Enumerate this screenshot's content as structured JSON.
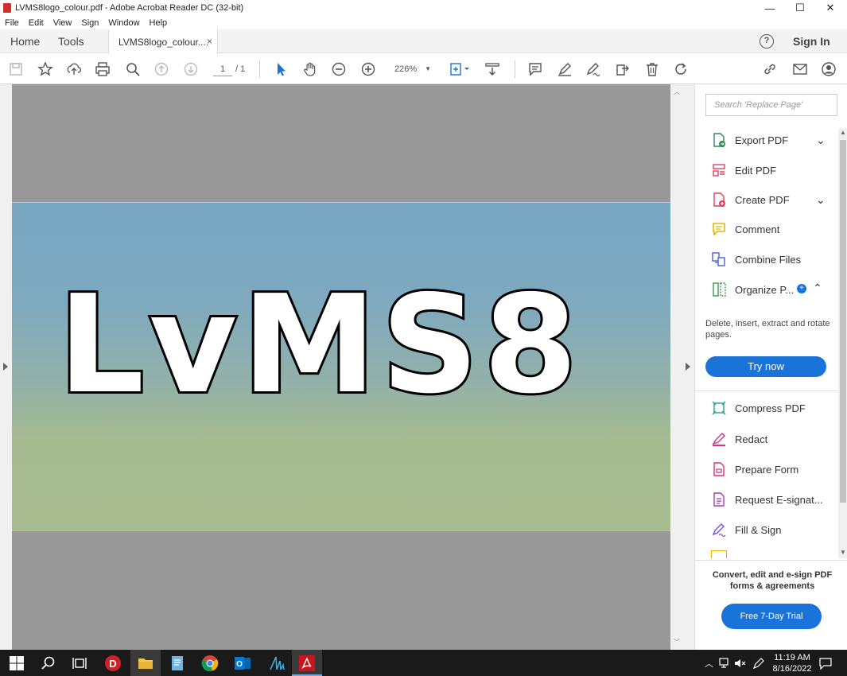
{
  "window": {
    "title": "LVMS8logo_colour.pdf - Adobe Acrobat Reader DC (32-bit)",
    "controls": {
      "minimize": "—",
      "maximize": "☐",
      "close": "✕"
    }
  },
  "menu": [
    "File",
    "Edit",
    "View",
    "Sign",
    "Window",
    "Help"
  ],
  "tabs": {
    "home": "Home",
    "tools": "Tools",
    "document": "LVMS8logo_colour....",
    "close": "×",
    "help": "?",
    "sign_in": "Sign In"
  },
  "toolbar": {
    "page_current": "1",
    "page_total": "/ 1",
    "zoom": "226%",
    "zoom_caret": "▼",
    "icons": [
      "save-icon",
      "bookmark-star-icon",
      "upload-cloud-icon",
      "print-icon",
      "find-icon",
      "previous-page-icon",
      "next-page-icon",
      "select-arrow-icon",
      "hand-icon",
      "zoom-out-icon",
      "zoom-in-icon",
      "fit-page-icon",
      "scroll-mode-icon",
      "comment-icon",
      "highlight-pen-icon",
      "sign-icon",
      "share-icon",
      "delete-icon",
      "rotate-icon",
      "link-icon",
      "mail-icon",
      "account-icon"
    ]
  },
  "document": {
    "logo_text": "LvMS8",
    "colors": {
      "top": "#79a8c4",
      "bottom": "#a9bc8f"
    }
  },
  "panel": {
    "search_placeholder": "Search 'Replace Page'",
    "tools": [
      {
        "label": "Export PDF",
        "icon": "export-pdf-icon",
        "color": "#2e8b57",
        "chevron": "⌄"
      },
      {
        "label": "Edit PDF",
        "icon": "edit-pdf-icon",
        "color": "#e0405f"
      },
      {
        "label": "Create PDF",
        "icon": "create-pdf-icon",
        "color": "#e0405f",
        "chevron": "⌄"
      },
      {
        "label": "Comment",
        "icon": "comment-tool-icon",
        "color": "#e5b800"
      },
      {
        "label": "Combine Files",
        "icon": "combine-files-icon",
        "color": "#4a5fd6"
      },
      {
        "label": "Organize P...",
        "icon": "organize-pages-icon",
        "color": "#3b9b4a",
        "chevron": "⌃"
      }
    ],
    "organize_desc": "Delete, insert, extract and rotate pages.",
    "try_now": "Try now",
    "tools2": [
      {
        "label": "Compress PDF",
        "icon": "compress-pdf-icon",
        "color": "#2aa198"
      },
      {
        "label": "Redact",
        "icon": "redact-icon",
        "color": "#d63384"
      },
      {
        "label": "Prepare Form",
        "icon": "prepare-form-icon",
        "color": "#d63384"
      },
      {
        "label": "Request E-signat...",
        "icon": "request-esign-icon",
        "color": "#a33bb5"
      },
      {
        "label": "Fill & Sign",
        "icon": "fill-sign-icon",
        "color": "#7b4fd4"
      }
    ],
    "promo": "Convert, edit and e-sign PDF forms & agreements",
    "trial": "Free 7-Day Trial"
  },
  "taskbar": {
    "time": "11:19 AM",
    "date": "8/16/2022"
  }
}
